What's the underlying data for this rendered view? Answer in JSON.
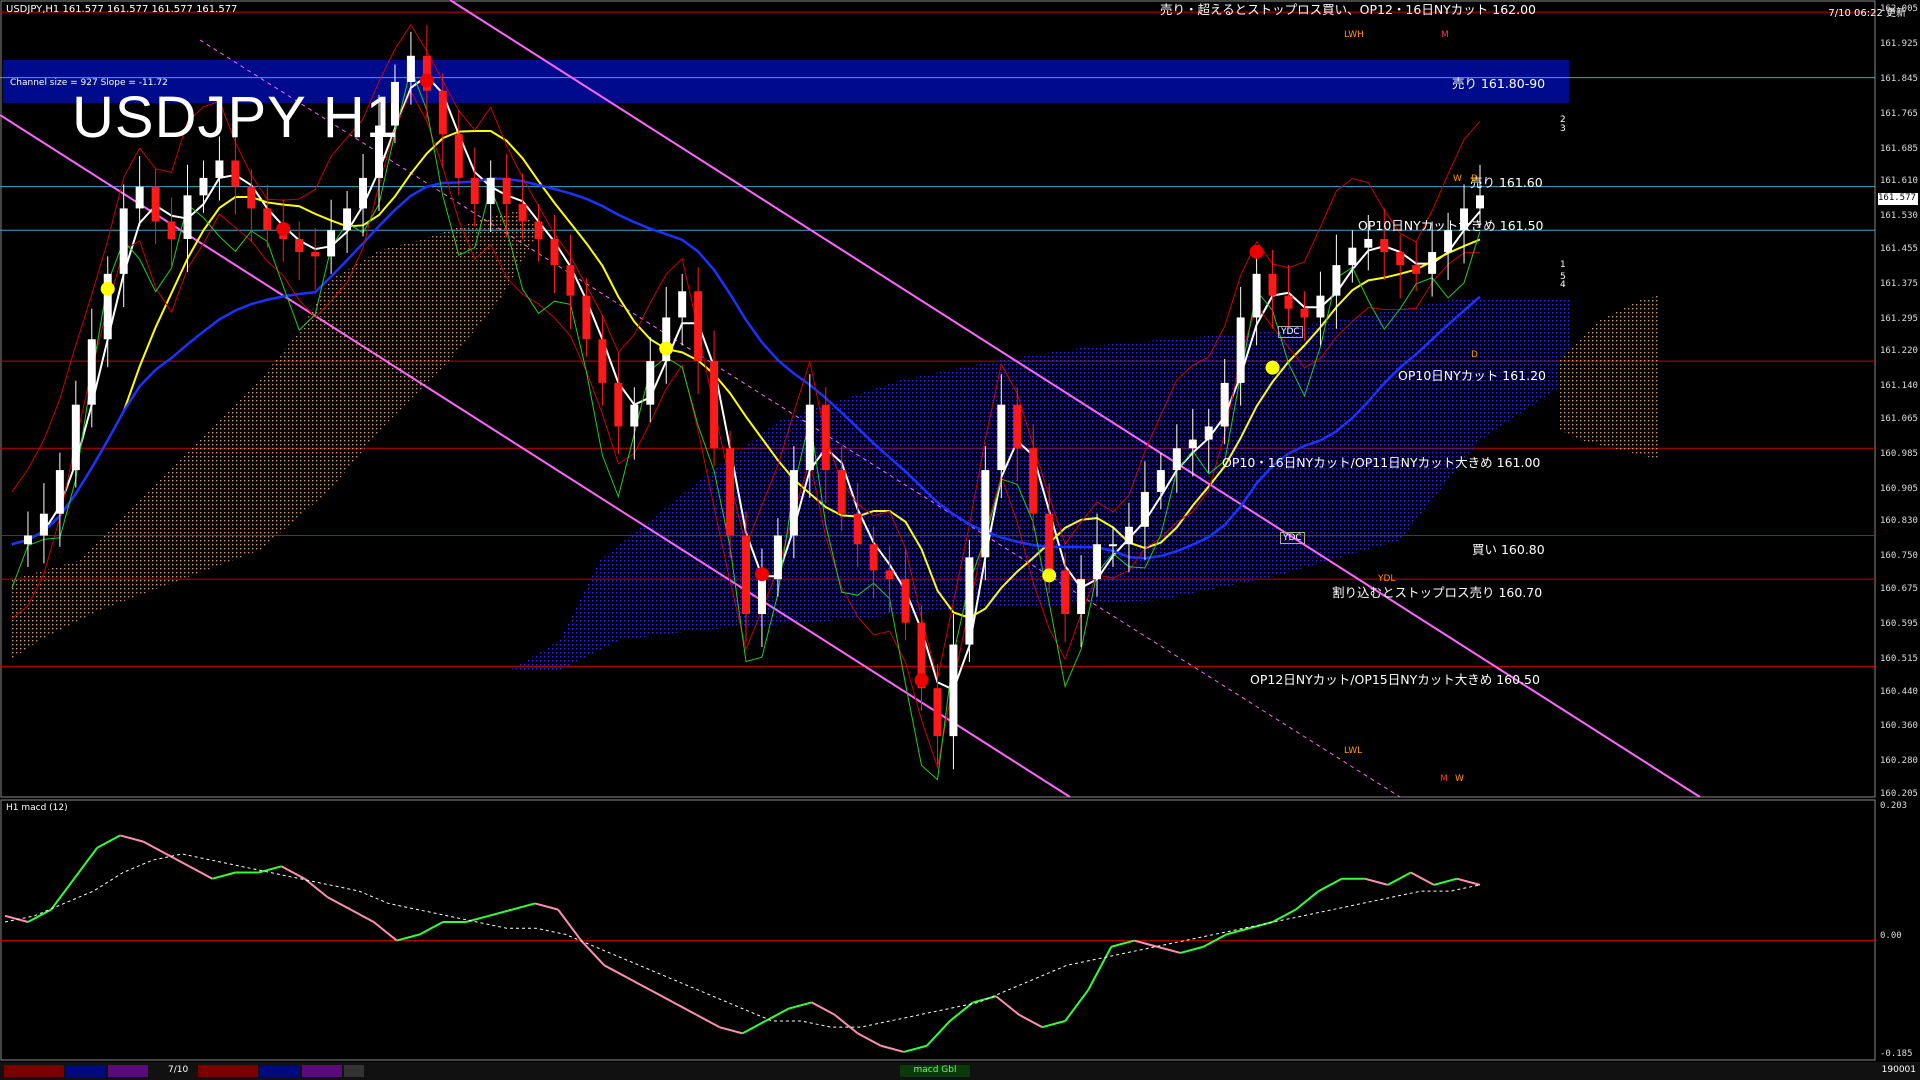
{
  "header": {
    "ohlc": "USDJPY,H1  161.577  161.577  161.577  161.577",
    "symbol_big": "USDJPY H1",
    "channel_info": "Channel size = 927  Slope = -11.72",
    "timestamp": "7/10 06:22 更新"
  },
  "notes": [
    {
      "id": "n162",
      "text": "売り・超えるとストップロス買い、OP12・16日NYカット 162.00"
    },
    {
      "id": "n1618",
      "text": "売り 161.80-90"
    },
    {
      "id": "n1616",
      "text": "売り 161.60"
    },
    {
      "id": "n1615",
      "text": "OP10日NYカット大きめ 161.50"
    },
    {
      "id": "n1612",
      "text": "OP10日NYカット 161.20"
    },
    {
      "id": "n1610",
      "text": "OP10・16日NYカット/OP11日NYカット大きめ 161.00"
    },
    {
      "id": "n1608",
      "text": "買い 160.80"
    },
    {
      "id": "n1607",
      "text": "割り込むとストップロス売り 160.70"
    },
    {
      "id": "n1605",
      "text": "OP12日NYカット/OP15日NYカット大きめ 160.50"
    }
  ],
  "price_axis": [
    "162.005",
    "161.925",
    "161.845",
    "161.765",
    "161.685",
    "161.610",
    "161.530",
    "161.455",
    "161.375",
    "161.295",
    "161.220",
    "161.140",
    "161.065",
    "160.985",
    "160.905",
    "160.830",
    "160.750",
    "160.675",
    "160.595",
    "160.515",
    "160.440",
    "160.360",
    "160.280",
    "160.205"
  ],
  "current_price": "161.577",
  "chart_labels": {
    "ydc1": "YDC",
    "ydc2": "YDC",
    "ydl": "YDL",
    "lwh": "LWH",
    "lwl": "LWL",
    "m1": "M",
    "m2": "M",
    "w1": "W",
    "w2": "W",
    "d1": "D",
    "d2": "D",
    "lvl1": "1",
    "lvl2": "2",
    "lvl3": "3",
    "lvl4": "4",
    "lvl5": "5"
  },
  "macd": {
    "label": "H1  macd (12)",
    "axis": [
      "0.203",
      "0.00",
      "-0.185"
    ],
    "taskbar_label": "macd Gbl"
  },
  "taskbar": {
    "date": "7/10",
    "right": "190001"
  },
  "colors": {
    "bg": "#000000",
    "up": "#ffffff",
    "down": "#ff1a1a",
    "ma_white": "#ffffff",
    "ma_yellow": "#ffff00",
    "ma_blue": "#1a33ff",
    "cloud": "#2b2bff",
    "channel": "#ff66ff",
    "macd_green": "#33ff33",
    "macd_pink": "#ff8fb0"
  },
  "chart_data": {
    "type": "candlestick",
    "title": "USDJPY H1",
    "ylim": [
      160.205,
      162.005
    ],
    "price_path": [
      160.78,
      160.8,
      160.85,
      160.95,
      161.1,
      161.25,
      161.4,
      161.55,
      161.6,
      161.52,
      161.48,
      161.58,
      161.62,
      161.66,
      161.6,
      161.55,
      161.5,
      161.48,
      161.45,
      161.44,
      161.5,
      161.55,
      161.62,
      161.74,
      161.84,
      161.9,
      161.82,
      161.72,
      161.62,
      161.56,
      161.62,
      161.56,
      161.52,
      161.48,
      161.42,
      161.35,
      161.25,
      161.15,
      161.05,
      161.1,
      161.2,
      161.3,
      161.36,
      161.2,
      161.0,
      160.8,
      160.62,
      160.7,
      160.8,
      160.95,
      161.1,
      160.95,
      160.85,
      160.78,
      160.72,
      160.7,
      160.6,
      160.45,
      160.34,
      160.55,
      160.75,
      160.95,
      161.1,
      161.0,
      160.85,
      160.72,
      160.62,
      160.7,
      160.78,
      160.78,
      160.82,
      160.9,
      160.95,
      161.0,
      161.02,
      161.05,
      161.15,
      161.3,
      161.4,
      161.35,
      161.32,
      161.3,
      161.35,
      161.42,
      161.46,
      161.48,
      161.45,
      161.42,
      161.4,
      161.45,
      161.5,
      161.55,
      161.58
    ],
    "levels": [
      162.0,
      161.85,
      161.6,
      161.5,
      161.2,
      161.0,
      160.8,
      160.7,
      160.5
    ],
    "macd_line": [
      0.04,
      0.03,
      0.05,
      0.1,
      0.15,
      0.17,
      0.16,
      0.14,
      0.12,
      0.1,
      0.11,
      0.11,
      0.12,
      0.1,
      0.07,
      0.05,
      0.03,
      0.0,
      0.01,
      0.03,
      0.03,
      0.04,
      0.05,
      0.06,
      0.05,
      0.0,
      -0.04,
      -0.06,
      -0.08,
      -0.1,
      -0.12,
      -0.14,
      -0.15,
      -0.13,
      -0.11,
      -0.1,
      -0.12,
      -0.15,
      -0.17,
      -0.18,
      -0.17,
      -0.13,
      -0.1,
      -0.09,
      -0.12,
      -0.14,
      -0.13,
      -0.08,
      -0.01,
      0.0,
      -0.01,
      -0.02,
      -0.01,
      0.01,
      0.02,
      0.03,
      0.05,
      0.08,
      0.1,
      0.1,
      0.09,
      0.11,
      0.09,
      0.1,
      0.09
    ],
    "macd_signal": [
      0.03,
      0.04,
      0.06,
      0.08,
      0.11,
      0.13,
      0.14,
      0.13,
      0.12,
      0.11,
      0.1,
      0.09,
      0.08,
      0.06,
      0.05,
      0.04,
      0.03,
      0.02,
      0.02,
      0.01,
      -0.01,
      -0.03,
      -0.05,
      -0.07,
      -0.09,
      -0.11,
      -0.13,
      -0.13,
      -0.14,
      -0.14,
      -0.13,
      -0.12,
      -0.11,
      -0.1,
      -0.08,
      -0.06,
      -0.04,
      -0.03,
      -0.02,
      -0.01,
      0.0,
      0.01,
      0.02,
      0.03,
      0.04,
      0.05,
      0.06,
      0.07,
      0.08,
      0.08,
      0.09
    ]
  }
}
